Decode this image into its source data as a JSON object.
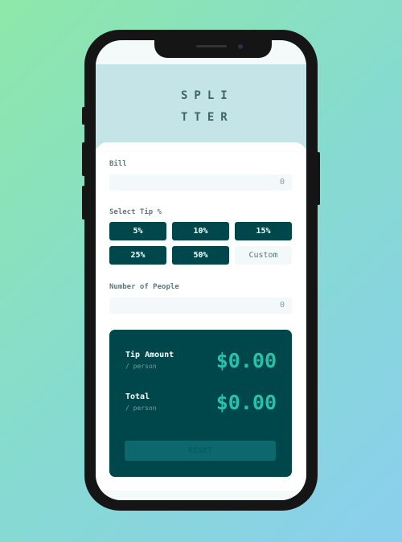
{
  "app": {
    "logo_line1": "SPLI",
    "logo_line2": "TTER"
  },
  "bill": {
    "label": "Bill",
    "value": "0"
  },
  "tips": {
    "label": "Select Tip %",
    "options": [
      "5%",
      "10%",
      "15%",
      "25%",
      "50%"
    ],
    "custom_placeholder": "Custom"
  },
  "people": {
    "label": "Number of People",
    "value": "0"
  },
  "results": {
    "tip_label": "Tip Amount",
    "tip_sub": "/ person",
    "tip_value": "$0.00",
    "total_label": "Total",
    "total_sub": "/ person",
    "total_value": "$0.00",
    "reset_label": "RESET"
  },
  "colors": {
    "dark_cyan": "#00474b",
    "accent": "#26c2ad",
    "header_bg": "#c5e4e7",
    "field_bg": "#f3f9fa"
  }
}
